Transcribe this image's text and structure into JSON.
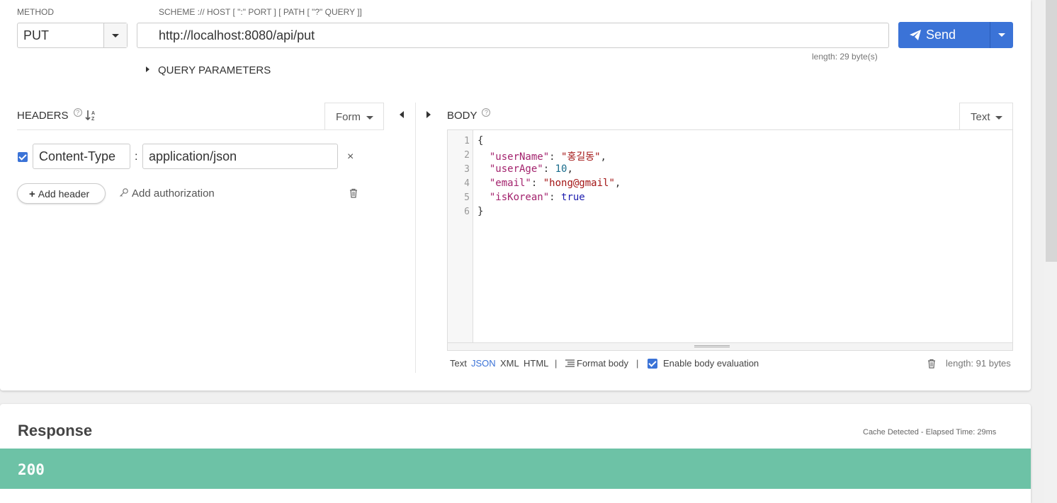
{
  "method": {
    "label": "METHOD",
    "value": "PUT"
  },
  "url": {
    "label": "SCHEME :// HOST [ \":\" PORT ] [ PATH [ \"?\" QUERY ]]",
    "value": "http://localhost:8080/api/put",
    "length": "length: 29 byte(s)"
  },
  "send": {
    "label": "Send"
  },
  "query_params": {
    "label": "QUERY PARAMETERS"
  },
  "headers": {
    "title": "HEADERS",
    "help": "?",
    "sort_glyph": "↓A Z",
    "mode": "Form",
    "rows": [
      {
        "enabled": true,
        "name": "Content-Type",
        "value": "application/json"
      }
    ],
    "separator": ":",
    "remove_glyph": "×",
    "add_header": "Add header",
    "add_authorization": "Add authorization"
  },
  "body": {
    "title": "BODY",
    "help": "?",
    "mode": "Text",
    "lines": [
      {
        "n": "1",
        "text": "{"
      },
      {
        "n": "2",
        "text": "  \"userName\": \"홍길동\","
      },
      {
        "n": "3",
        "text": "  \"userAge\": 10,"
      },
      {
        "n": "4",
        "text": "  \"email\": \"hong@gmail\","
      },
      {
        "n": "5",
        "text": "  \"isKorean\": true"
      },
      {
        "n": "6",
        "text": "}"
      }
    ],
    "formats": [
      "Text",
      "JSON",
      "XML",
      "HTML"
    ],
    "active_format": "JSON",
    "separator": "|",
    "format_body": "Format body",
    "enable_eval": "Enable body evaluation",
    "enable_eval_checked": true,
    "length": "length: 91 bytes"
  },
  "response": {
    "title": "Response",
    "cache": "Cache Detected - Elapsed Time: 29ms",
    "status": "200",
    "status_color": "#6dc2a6"
  },
  "colors": {
    "accent": "#3b73d7"
  }
}
